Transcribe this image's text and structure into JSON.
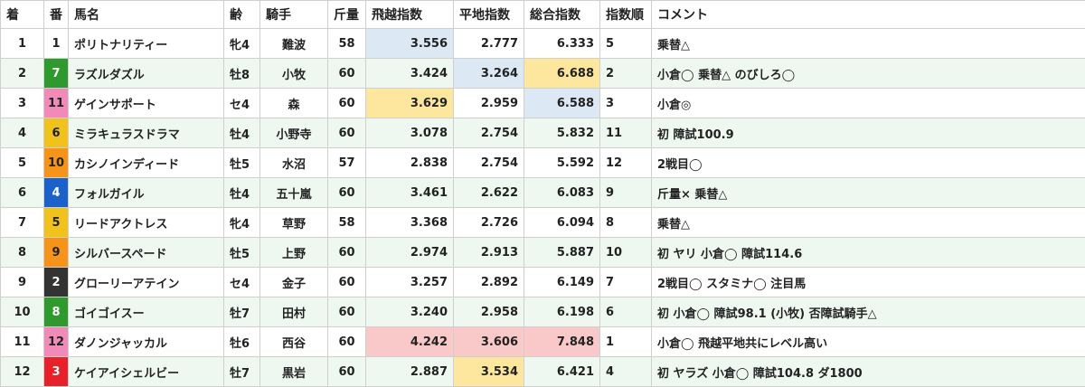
{
  "headers": [
    "着",
    "番",
    "馬名",
    "齢",
    "騎手",
    "斤量",
    "飛越指数",
    "平地指数",
    "総合指数",
    "指数順",
    "コメント"
  ],
  "rows": [
    {
      "chaku": "1",
      "ban": "1",
      "name": "ポリトナリティー",
      "rei": "牝4",
      "jockey": "難波",
      "kinryo": "58",
      "hietsu": "3.556",
      "heichi": "2.777",
      "sogo": "6.333",
      "jun": "5",
      "comment": "乗替△"
    },
    {
      "chaku": "2",
      "ban": "7",
      "name": "ラズルダズル",
      "rei": "牡8",
      "jockey": "小牧",
      "kinryo": "60",
      "hietsu": "3.424",
      "heichi": "3.264",
      "sogo": "6.688",
      "jun": "2",
      "comment": "小倉◯ 乗替△ のびしろ◯"
    },
    {
      "chaku": "3",
      "ban": "11",
      "name": "ゲインサポート",
      "rei": "セ4",
      "jockey": "森",
      "kinryo": "60",
      "hietsu": "3.629",
      "heichi": "2.959",
      "sogo": "6.588",
      "jun": "3",
      "comment": "小倉◎"
    },
    {
      "chaku": "4",
      "ban": "6",
      "name": "ミラキュラスドラマ",
      "rei": "牡4",
      "jockey": "小野寺",
      "kinryo": "60",
      "hietsu": "3.078",
      "heichi": "2.754",
      "sogo": "5.832",
      "jun": "11",
      "comment": "初 障試100.9"
    },
    {
      "chaku": "5",
      "ban": "10",
      "name": "カシノインディード",
      "rei": "牡5",
      "jockey": "水沼",
      "kinryo": "57",
      "hietsu": "2.838",
      "heichi": "2.754",
      "sogo": "5.592",
      "jun": "12",
      "comment": "2戦目◯"
    },
    {
      "chaku": "6",
      "ban": "4",
      "name": "フォルガイル",
      "rei": "牡4",
      "jockey": "五十嵐",
      "kinryo": "60",
      "hietsu": "3.461",
      "heichi": "2.622",
      "sogo": "6.083",
      "jun": "9",
      "comment": "斤量× 乗替△"
    },
    {
      "chaku": "7",
      "ban": "5",
      "name": "リードアクトレス",
      "rei": "牝4",
      "jockey": "草野",
      "kinryo": "58",
      "hietsu": "3.368",
      "heichi": "2.726",
      "sogo": "6.094",
      "jun": "8",
      "comment": "乗替△"
    },
    {
      "chaku": "8",
      "ban": "9",
      "name": "シルバースペード",
      "rei": "牡5",
      "jockey": "上野",
      "kinryo": "60",
      "hietsu": "2.974",
      "heichi": "2.913",
      "sogo": "5.887",
      "jun": "10",
      "comment": "初 ヤリ 小倉◯ 障試114.6"
    },
    {
      "chaku": "9",
      "ban": "2",
      "name": "グローリーアテイン",
      "rei": "セ4",
      "jockey": "金子",
      "kinryo": "60",
      "hietsu": "3.257",
      "heichi": "2.892",
      "sogo": "6.149",
      "jun": "7",
      "comment": "2戦目◯ スタミナ◯ 注目馬"
    },
    {
      "chaku": "10",
      "ban": "8",
      "name": "ゴイゴイスー",
      "rei": "牡7",
      "jockey": "田村",
      "kinryo": "60",
      "hietsu": "3.240",
      "heichi": "2.958",
      "sogo": "6.198",
      "jun": "6",
      "comment": "初 小倉◯ 障試98.1 (小牧) 否障試騎手△"
    },
    {
      "chaku": "11",
      "ban": "12",
      "name": "ダノンジャッカル",
      "rei": "牡6",
      "jockey": "西谷",
      "kinryo": "60",
      "hietsu": "4.242",
      "heichi": "3.606",
      "sogo": "7.848",
      "jun": "1",
      "comment": "小倉◯ 飛越平地共にレベル高い"
    },
    {
      "chaku": "12",
      "ban": "3",
      "name": "ケイアイシェルビー",
      "rei": "牡7",
      "jockey": "黒岩",
      "kinryo": "60",
      "hietsu": "2.887",
      "heichi": "3.534",
      "sogo": "6.421",
      "jun": "4",
      "comment": "初 ヤラズ 小倉◯ 障試104.8 ダ1800"
    }
  ],
  "gate_colors": {
    "1": {
      "bg": "#ffffff",
      "fg": "#222222"
    },
    "2": {
      "bg": "#333333",
      "fg": "#ffffff"
    },
    "3": {
      "bg": "#e8202a",
      "fg": "#ffffff"
    },
    "4": {
      "bg": "#1a62c9",
      "fg": "#ffffff"
    },
    "5": {
      "bg": "#f2c21c",
      "fg": "#222222"
    },
    "6": {
      "bg": "#f2c21c",
      "fg": "#222222"
    },
    "7": {
      "bg": "#2e9a2e",
      "fg": "#ffffff"
    },
    "8": {
      "bg": "#2e9a2e",
      "fg": "#ffffff"
    },
    "9": {
      "bg": "#f59418",
      "fg": "#222222"
    },
    "10": {
      "bg": "#f59418",
      "fg": "#222222"
    },
    "11": {
      "bg": "#f08ab8",
      "fg": "#222222"
    },
    "12": {
      "bg": "#f08ab8",
      "fg": "#222222"
    }
  },
  "highlights": {
    "0-hietsu": "blue",
    "1-heichi": "blue",
    "1-sogo": "yellow",
    "2-hietsu": "yellow",
    "2-sogo": "blue",
    "10-hietsu": "red",
    "10-heichi": "red",
    "10-sogo": "red",
    "11-heichi": "yellow"
  }
}
